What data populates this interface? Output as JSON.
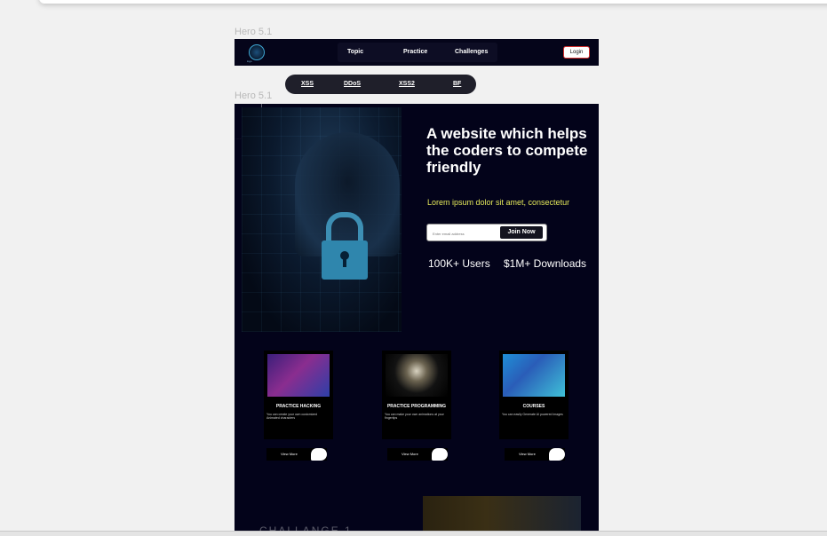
{
  "frame_labels": [
    "Hero 5.1",
    "Hero 5.1"
  ],
  "nav": {
    "logo_text": "logo",
    "links": [
      "Topic",
      "Practice",
      "Challenges"
    ],
    "login": "Login"
  },
  "pill_nav": [
    "XSS",
    "DDoS",
    "XSS2",
    "BF"
  ],
  "hero": {
    "title": "A website which helps the coders to compete friendly",
    "subtitle": "Lorem ipsum dolor sit amet, consectetur",
    "email_placeholder": "Enter email address",
    "join_button": "Join Now",
    "stats": [
      "100K+ Users",
      "$1M+ Downloads"
    ]
  },
  "cards": [
    {
      "title": "PRACTICE HACKING",
      "desc": "You can create your own customized Animated characters"
    },
    {
      "title": "PRACTICE PROGRAMMING",
      "desc": "You can make your own animations at your fingertips"
    },
    {
      "title": "COURSES",
      "desc": "You can easily Generate AI powered images"
    }
  ],
  "view_more": "View More",
  "challenge_heading": "CHALLANGE 1",
  "colors": {
    "hero_bg": "#03031a",
    "accent_yellow": "#e3e75a",
    "login_border": "#d62d2d",
    "lock_blue": "#2f86ad"
  },
  "icons": [
    "logo-icon",
    "lock-icon",
    "view-more-blob-icon"
  ]
}
